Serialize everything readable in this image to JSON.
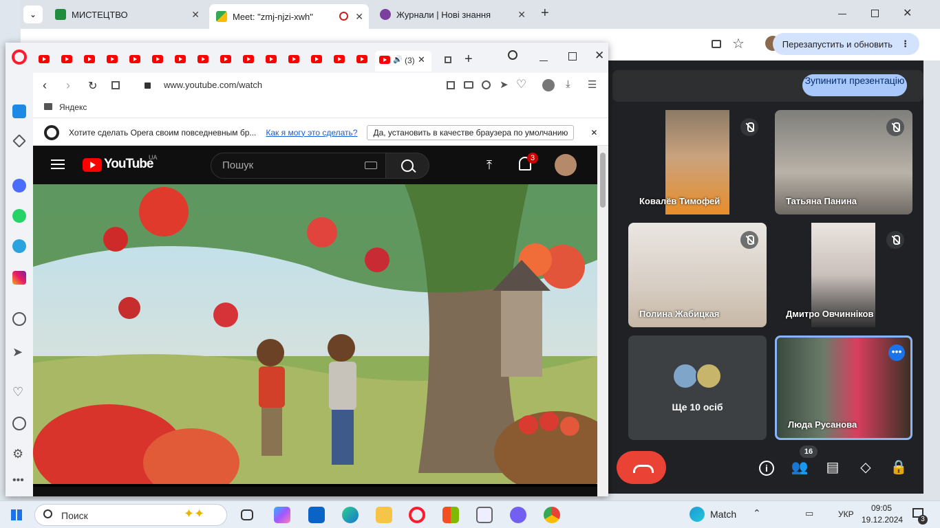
{
  "chrome": {
    "tabs": [
      {
        "label": "МИСТЕЦТВО",
        "icon": "classroom-icon"
      },
      {
        "label": "Meet: \"zmj-njzi-xwh\"",
        "icon": "meet-icon",
        "active": true
      },
      {
        "label": "Журнали | Нові знання",
        "icon": "journal-icon"
      }
    ],
    "restart_label": "Перезапустить и обновить"
  },
  "meet": {
    "stop_presentation_label": "Зупинити презентацію",
    "participants": [
      {
        "name": "Ковалёв Тимофей",
        "muted": true
      },
      {
        "name": "Татьяна Панина",
        "muted": true
      },
      {
        "name": "Полина Жабицкая",
        "muted": true
      },
      {
        "name": "Дмитро Овчинніков",
        "muted": true
      },
      {
        "name": "Ще 10 осіб",
        "muted": false
      },
      {
        "name": "Люда Русанова",
        "muted": false
      }
    ],
    "people_count": "16"
  },
  "opera": {
    "audio_tab_label": "(3)",
    "url": "www.youtube.com/watch",
    "bookmark": "Яндекс",
    "banner_text": "Хотите сделать Opera своим повседневным бр...",
    "banner_link": "Как я могу это сделать?",
    "banner_button": "Да, установить в качестве браузера по умолчанию"
  },
  "youtube": {
    "logo": "YouTube",
    "region": "UA",
    "search_placeholder": "Пошук",
    "notification_count": "3"
  },
  "taskbar": {
    "search_label": "Поиск",
    "weather_label": "Match",
    "language": "УКР",
    "time": "09:05",
    "date": "19.12.2024",
    "notification_count": "3"
  }
}
